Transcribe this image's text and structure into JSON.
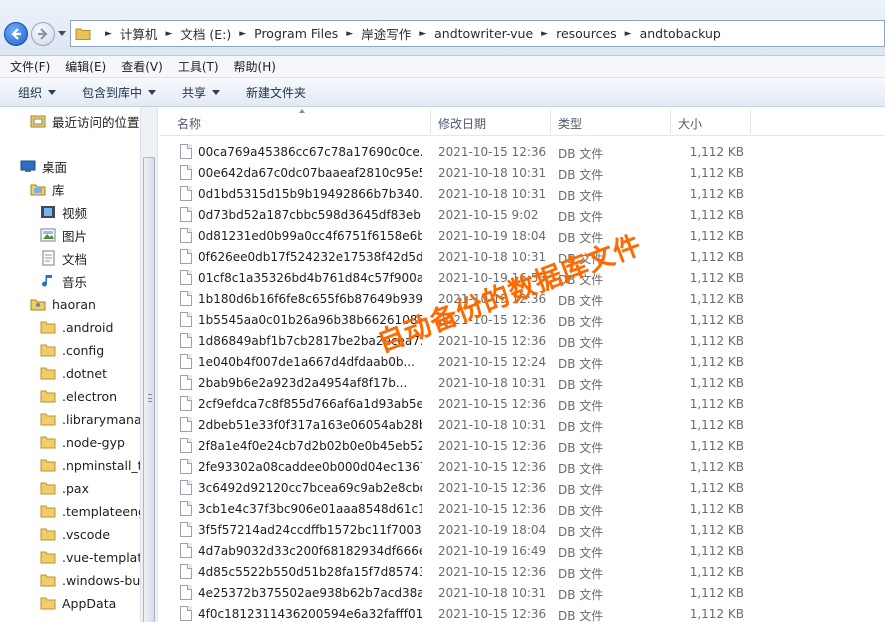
{
  "address_bar": {
    "breadcrumbs": [
      "计算机",
      "文档 (E:)",
      "Program Files",
      "岸途写作",
      "andtowriter-vue",
      "resources",
      "andtobackup"
    ]
  },
  "menu": [
    "文件(F)",
    "编辑(E)",
    "查看(V)",
    "工具(T)",
    "帮助(H)"
  ],
  "toolbar": {
    "organize": "组织",
    "include_in_library": "包含到库中",
    "share": "共享",
    "new_folder": "新建文件夹"
  },
  "nav_pane": {
    "items": [
      {
        "label": "最近访问的位置",
        "icon": "recent-places-icon"
      },
      {
        "label": "桌面",
        "icon": "desktop-icon"
      },
      {
        "label": "库",
        "icon": "libraries-icon"
      },
      {
        "label": "视频",
        "icon": "video-icon"
      },
      {
        "label": "图片",
        "icon": "pictures-icon"
      },
      {
        "label": "文档",
        "icon": "documents-icon"
      },
      {
        "label": "音乐",
        "icon": "music-icon"
      },
      {
        "label": "haoran",
        "icon": "user-folder-icon"
      },
      {
        "label": ".android",
        "icon": "folder-icon"
      },
      {
        "label": ".config",
        "icon": "folder-icon"
      },
      {
        "label": ".dotnet",
        "icon": "folder-icon"
      },
      {
        "label": ".electron",
        "icon": "folder-icon"
      },
      {
        "label": ".librarymanag",
        "icon": "folder-icon"
      },
      {
        "label": ".node-gyp",
        "icon": "folder-icon"
      },
      {
        "label": ".npminstall_ta",
        "icon": "folder-icon"
      },
      {
        "label": ".pax",
        "icon": "folder-icon"
      },
      {
        "label": ".templateengi",
        "icon": "folder-icon"
      },
      {
        "label": ".vscode",
        "icon": "folder-icon"
      },
      {
        "label": ".vue-template",
        "icon": "folder-icon"
      },
      {
        "label": ".windows-buil",
        "icon": "folder-icon"
      },
      {
        "label": "AppData",
        "icon": "folder-icon"
      }
    ]
  },
  "columns": {
    "name": "名称",
    "date": "修改日期",
    "type": "类型",
    "size": "大小"
  },
  "files": [
    {
      "name": "00ca769a45386cc67c78a17690c0ce...",
      "date": "2021-10-15 12:36",
      "type": "DB 文件",
      "size": "1,112 KB"
    },
    {
      "name": "00e642da67c0dc07baaeaf2810c95e5...",
      "date": "2021-10-18 10:31",
      "type": "DB 文件",
      "size": "1,112 KB"
    },
    {
      "name": "0d1bd5315d15b9b19492866b7b340...",
      "date": "2021-10-18 10:31",
      "type": "DB 文件",
      "size": "1,112 KB"
    },
    {
      "name": "0d73bd52a187cbbc598d3645df83eb...",
      "date": "2021-10-15 9:02",
      "type": "DB 文件",
      "size": "1,112 KB"
    },
    {
      "name": "0d81231ed0b99a0cc4f6751f6158e6b...",
      "date": "2021-10-19 18:04",
      "type": "DB 文件",
      "size": "1,112 KB"
    },
    {
      "name": "0f626ee0db17f524232e17538f42d5d...",
      "date": "2021-10-18 10:31",
      "type": "DB 文件",
      "size": "1,112 KB"
    },
    {
      "name": "01cf8c1a35326bd4b761d84c57f900a...",
      "date": "2021-10-19 16:53",
      "type": "DB 文件",
      "size": "1,112 KB"
    },
    {
      "name": "1b180d6b16f6fe8c655f6b87649b939...",
      "date": "2021-10-15 12:36",
      "type": "DB 文件",
      "size": "1,112 KB"
    },
    {
      "name": "1b5545aa0c01b26a96b38b66261088...",
      "date": "2021-10-15 12:36",
      "type": "DB 文件",
      "size": "1,112 KB"
    },
    {
      "name": "1d86849abf1b7cb2817be2ba2ecea7...",
      "date": "2021-10-15 12:36",
      "type": "DB 文件",
      "size": "1,112 KB"
    },
    {
      "name": "1e040b4f007de1a667d4dfdaab0b...",
      "date": "2021-10-15 12:24",
      "type": "DB 文件",
      "size": "1,112 KB"
    },
    {
      "name": "2bab9b6e2a923d2a4954af8f17b...",
      "date": "2021-10-18 10:31",
      "type": "DB 文件",
      "size": "1,112 KB"
    },
    {
      "name": "2cf9efdca7c8f855d766af6a1d93ab5e...",
      "date": "2021-10-15 12:36",
      "type": "DB 文件",
      "size": "1,112 KB"
    },
    {
      "name": "2dbeb51e33f0f317a163e06054ab28b...",
      "date": "2021-10-18 10:31",
      "type": "DB 文件",
      "size": "1,112 KB"
    },
    {
      "name": "2f8a1e4f0e24cb7d2b02b0e0b45eb52...",
      "date": "2021-10-15 12:36",
      "type": "DB 文件",
      "size": "1,112 KB"
    },
    {
      "name": "2fe93302a08caddee0b000d04ec1367...",
      "date": "2021-10-15 12:36",
      "type": "DB 文件",
      "size": "1,112 KB"
    },
    {
      "name": "3c6492d92120cc7bcea69c9ab2e8cbd...",
      "date": "2021-10-15 12:36",
      "type": "DB 文件",
      "size": "1,112 KB"
    },
    {
      "name": "3cb1e4c37f3bc906e01aaa8548d61c1...",
      "date": "2021-10-15 12:36",
      "type": "DB 文件",
      "size": "1,112 KB"
    },
    {
      "name": "3f5f57214ad24ccdffb1572bc11f7003...",
      "date": "2021-10-19 18:04",
      "type": "DB 文件",
      "size": "1,112 KB"
    },
    {
      "name": "4d7ab9032d33c200f68182934df666e...",
      "date": "2021-10-19 16:49",
      "type": "DB 文件",
      "size": "1,112 KB"
    },
    {
      "name": "4d85c5522b550d51b28fa15f7d85743...",
      "date": "2021-10-15 12:36",
      "type": "DB 文件",
      "size": "1,112 KB"
    },
    {
      "name": "4e25372b375502ae938b62b7acd38a...",
      "date": "2021-10-18 10:31",
      "type": "DB 文件",
      "size": "1,112 KB"
    },
    {
      "name": "4f0c1812311436200594e6a32fafff01...",
      "date": "2021-10-15 12:36",
      "type": "DB 文件",
      "size": "1,112 KB"
    }
  ],
  "annotation": {
    "text": "自动备份的数据库文件",
    "color": "#ff6a00"
  }
}
